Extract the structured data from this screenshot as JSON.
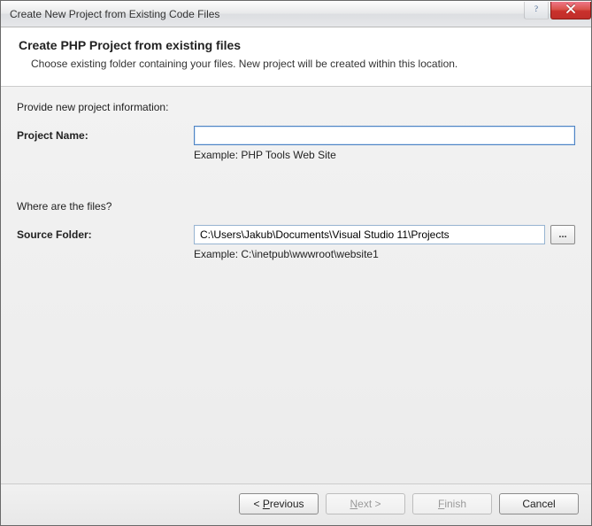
{
  "window": {
    "title": "Create New Project from Existing Code Files"
  },
  "header": {
    "title": "Create PHP Project from existing files",
    "subtitle": "Choose existing folder containing your files. New project will be created within this location."
  },
  "section1": {
    "label": "Provide new project information:"
  },
  "projectName": {
    "label": "Project Name:",
    "value": "",
    "example": "Example: PHP Tools Web Site"
  },
  "section2": {
    "label": "Where are the files?"
  },
  "sourceFolder": {
    "label": "Source Folder:",
    "value": "C:\\Users\\Jakub\\Documents\\Visual Studio 11\\Projects",
    "browse": "...",
    "example": "Example: C:\\inetpub\\wwwroot\\website1"
  },
  "footer": {
    "previous_pre": "< ",
    "previous_accel": "P",
    "previous_post": "revious",
    "next_accel": "N",
    "next_post": "ext >",
    "finish_accel": "F",
    "finish_post": "inish",
    "cancel": "Cancel"
  }
}
